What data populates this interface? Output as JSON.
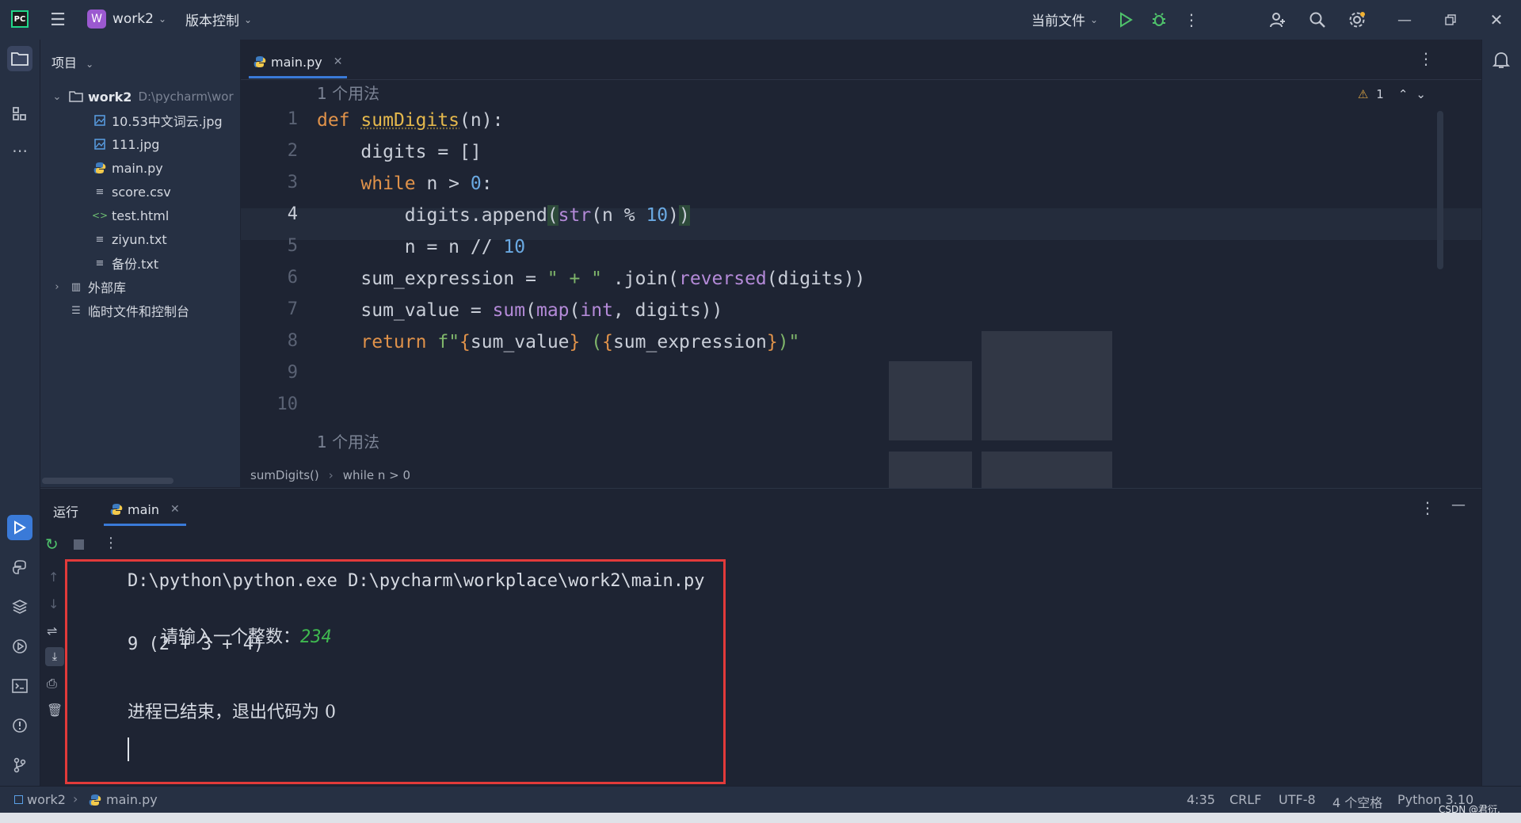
{
  "titlebar": {
    "project_badge": "W",
    "project_name": "work2",
    "vcs_label": "版本控制",
    "run_config": "当前文件"
  },
  "project_panel": {
    "title": "项目",
    "root": {
      "name": "work2",
      "path": "D:\\pycharm\\wor"
    },
    "files": [
      "10.53中文词云.jpg",
      "111.jpg",
      "main.py",
      "score.csv",
      "test.html",
      "ziyun.txt",
      "备份.txt"
    ],
    "external_libs": "外部库",
    "scratches": "临时文件和控制台"
  },
  "editor": {
    "tab": "main.py",
    "warning_count": "1",
    "usage_hint_top": "1 个用法",
    "usage_hint_bottom": "1 个用法",
    "line_numbers": [
      "1",
      "2",
      "3",
      "4",
      "5",
      "6",
      "7",
      "8",
      "9",
      "10"
    ],
    "breadcrumb": [
      "sumDigits()",
      "while n > 0"
    ]
  },
  "run_panel": {
    "title": "运行",
    "tab": "main",
    "console": {
      "command": "D:\\python\\python.exe D:\\pycharm\\workplace\\work2\\main.py",
      "prompt": "请输入一个整数：",
      "input": "234",
      "result": "9 (2 + 3 + 4)",
      "exit": "进程已结束，退出代码为 0"
    }
  },
  "statusbar": {
    "project": "work2",
    "file": "main.py",
    "position": "4:35",
    "line_sep": "CRLF",
    "encoding": "UTF-8",
    "indent": "4 个空格",
    "interpreter": "Python 3.10",
    "watermark": "CSDN @君衍."
  },
  "colors": {
    "background": "#1e2433",
    "panel": "#263043",
    "accent": "#3a7ad8",
    "highlight_box": "#e23a3a",
    "keyword": "#e0924a",
    "string": "#7fb56a",
    "number": "#6aa9e2"
  }
}
